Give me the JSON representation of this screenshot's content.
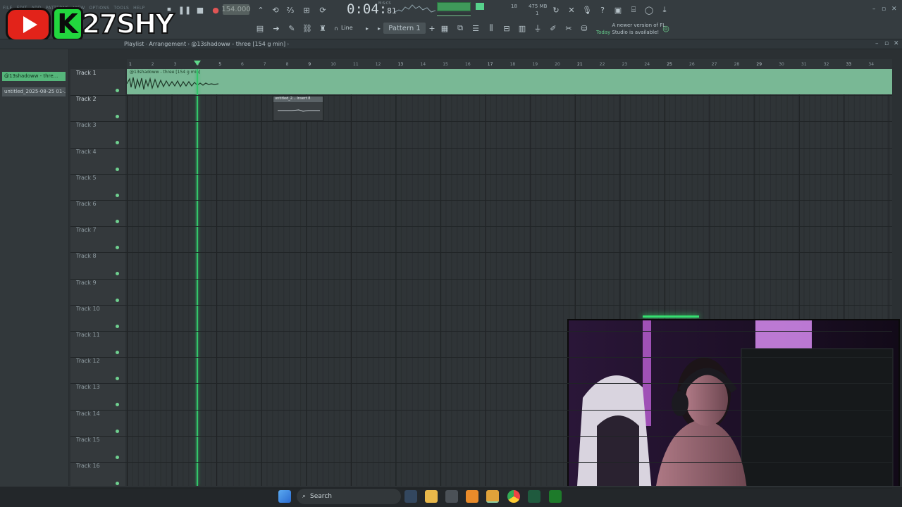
{
  "toolbar": {
    "menu": [
      "FILE",
      "EDIT",
      "ADD",
      "PATTERNS",
      "VIEW",
      "OPTIONS",
      "TOOLS",
      "HELP"
    ],
    "tempo": "154.000",
    "clock_main": "0:04",
    "clock_sub": "81",
    "clock_unit": "M:S:CS",
    "cpu_label": "18",
    "ram": "475 MB",
    "voices": "1",
    "pattern": "Pattern 1",
    "snap": "Line",
    "news_today": "Today",
    "news_text": "A newer version of FL Studio is available!"
  },
  "overlay_brand": "27SHY",
  "overlay_letter": "K",
  "playlist": {
    "breadcrumb": [
      "Playlist",
      "Arrangement",
      "@13shadoww - three [154 g min]"
    ]
  },
  "browser": {
    "items": [
      "@13shadoww - thre...",
      "untitled_2025-08-25 01-..."
    ]
  },
  "tracks": [
    "Track 1",
    "Track 2",
    "Track 3",
    "Track 4",
    "Track 5",
    "Track 6",
    "Track 7",
    "Track 8",
    "Track 9",
    "Track 10",
    "Track 11",
    "Track 12",
    "Track 13",
    "Track 14",
    "Track 15",
    "Track 16"
  ],
  "ruler": [
    "1",
    "2",
    "3",
    "4",
    "5",
    "6",
    "7",
    "8",
    "9",
    "10",
    "11",
    "12",
    "13",
    "14",
    "15",
    "16",
    "17",
    "18",
    "19",
    "20",
    "21",
    "22",
    "23",
    "24",
    "25",
    "26",
    "27",
    "28",
    "29",
    "30",
    "31",
    "32",
    "33",
    "34"
  ],
  "clips": {
    "audio_clip": "@13shadoww - three [154 g min]",
    "clip2": "untitled_2... Insert 8"
  },
  "taskbar": {
    "search": "Search"
  },
  "colors": {
    "accent_green": "#33c56a",
    "clip_green": "#79b895",
    "bg": "#2b3033"
  }
}
